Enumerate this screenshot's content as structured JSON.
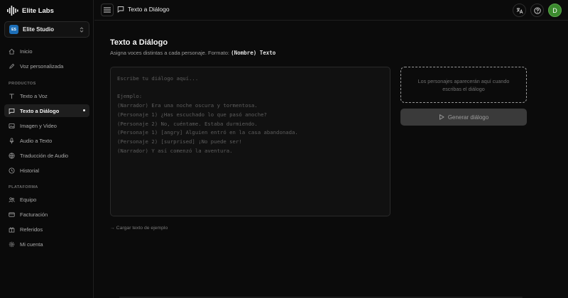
{
  "brand": {
    "name": "Elite Labs"
  },
  "workspace": {
    "name": "Elite Studio",
    "avatar_text": "ES"
  },
  "sidebar": {
    "top_items": [
      {
        "label": "Inicio",
        "icon": "home-icon"
      },
      {
        "label": "Voz personalizada",
        "icon": "pen-icon"
      }
    ],
    "sections": [
      {
        "title": "PRODUCTOS"
      },
      {
        "title": "PLATAFORMA"
      }
    ],
    "product_items": [
      {
        "label": "Texto a Voz",
        "icon": "text-icon"
      },
      {
        "label": "Texto a Diálogo",
        "icon": "chat-icon",
        "active": true
      },
      {
        "label": "Imagen y Video",
        "icon": "image-icon"
      },
      {
        "label": "Audio a Texto",
        "icon": "mic-icon"
      },
      {
        "label": "Traducción de Audio",
        "icon": "globe-icon"
      },
      {
        "label": "Historial",
        "icon": "history-icon"
      }
    ],
    "platform_items": [
      {
        "label": "Equipo",
        "icon": "team-icon"
      },
      {
        "label": "Facturación",
        "icon": "card-icon"
      },
      {
        "label": "Referidos",
        "icon": "gift-icon"
      },
      {
        "label": "Mi cuenta",
        "icon": "settings-icon"
      }
    ]
  },
  "topbar": {
    "breadcrumb": "Texto a Diálogo",
    "user_initial": "D"
  },
  "main": {
    "title": "Texto a Diálogo",
    "subtitle": "Asigna voces distintas a cada personaje. Formato:",
    "format_code": "(Nombre) Texto",
    "editor_placeholder": "Escribe tu diálogo aquí...\n\nEjemplo:\n(Narrador) Era una noche oscura y tormentosa.\n(Personaje 1) ¿Has escuchado lo que pasó anoche?\n(Personaje 2) No, cuéntame. Estaba durmiendo.\n(Personaje 1) [angry] Alguien entró en la casa abandonada.\n(Personaje 2) [surprised] ¡No puede ser!\n(Narrador) Y así comenzó la aventura.",
    "load_sample": "→ Cargar texto de ejemplo",
    "characters_hint": "Los personajes aparecerán aquí cuando escribas el diálogo",
    "generate_label": "Generar diálogo"
  },
  "colors": {
    "background": "#0b0b0b",
    "active_item": "#1e1e1e",
    "avatar_green": "#3b8a2e",
    "workspace_blue": "#1d6fb8"
  }
}
